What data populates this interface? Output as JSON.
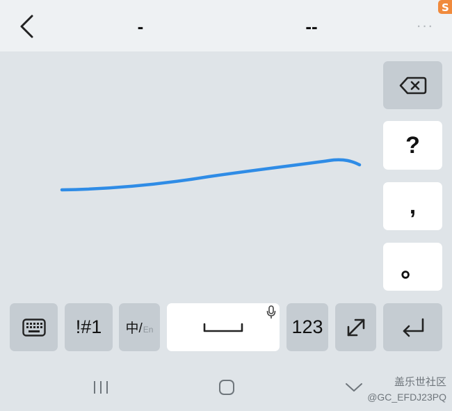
{
  "topbar": {
    "candidates": [
      "-",
      "--"
    ],
    "more_label": "···"
  },
  "side_keys": {
    "question": "?",
    "comma": ",",
    "period": "。"
  },
  "bottom_row": {
    "symbols_label": "!#1",
    "lang_main": "中/",
    "lang_sub": "En",
    "numbers_label": "123"
  },
  "watermark": {
    "line1": "盖乐世社区",
    "line2": "@GC_EFDJ23PQ"
  },
  "colors": {
    "stroke": "#2f8ce6",
    "background": "#dfe4e8",
    "topbar": "#eef1f3",
    "gray_key": "#c5ccd2",
    "white_key": "#ffffff"
  }
}
